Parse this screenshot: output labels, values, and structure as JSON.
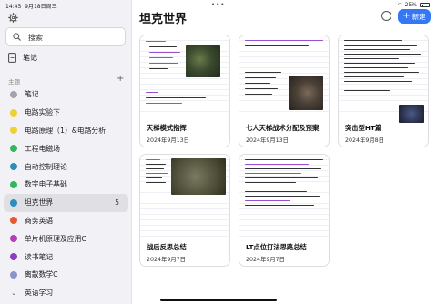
{
  "status": {
    "time": "14:45",
    "date": "9月18日周三",
    "battery": "25%"
  },
  "sidebar": {
    "search_label": "搜索",
    "notes_label": "笔记",
    "section_label": "主题",
    "topics": [
      {
        "label": "笔记",
        "color": "#a0a4ae",
        "count": ""
      },
      {
        "label": "电路实验下",
        "color": "#f0d132",
        "count": ""
      },
      {
        "label": "电路原理（1）&电路分析",
        "color": "#f0d132",
        "count": ""
      },
      {
        "label": "工程电磁场",
        "color": "#2fb95c",
        "count": ""
      },
      {
        "label": "自动控制理论",
        "color": "#2c8db8",
        "count": ""
      },
      {
        "label": "数字电子基础",
        "color": "#2fb95c",
        "count": ""
      },
      {
        "label": "坦克世界",
        "color": "#2a8fc0",
        "count": "5"
      },
      {
        "label": "商务英语",
        "color": "#e8572f",
        "count": ""
      },
      {
        "label": "单片机原理及应用C",
        "color": "#b23fb6",
        "count": ""
      },
      {
        "label": "读书笔记",
        "color": "#8a3fc0",
        "count": ""
      },
      {
        "label": "离散数学C",
        "color": "#8a94c8",
        "count": ""
      }
    ],
    "collapsed_item": "英语学习"
  },
  "main": {
    "title": "坦克世界",
    "new_label": "新建",
    "cards": [
      {
        "title": "天梯模式指挥",
        "date": "2024年9月13日"
      },
      {
        "title": "七人天梯战术分配及预案",
        "date": "2024年9月13日"
      },
      {
        "title": "突击型HT篇",
        "date": "2024年9月8日"
      },
      {
        "title": "战后反思总结",
        "date": "2024年9月7日"
      },
      {
        "title": "LT点位打法思路总结",
        "date": "2024年9月7日"
      }
    ]
  },
  "colors": {
    "accent": "#3478f6",
    "sidebar_bg": "#f2f2f6",
    "ink_purple": "#9a4fd0",
    "ink_black": "#333333"
  }
}
